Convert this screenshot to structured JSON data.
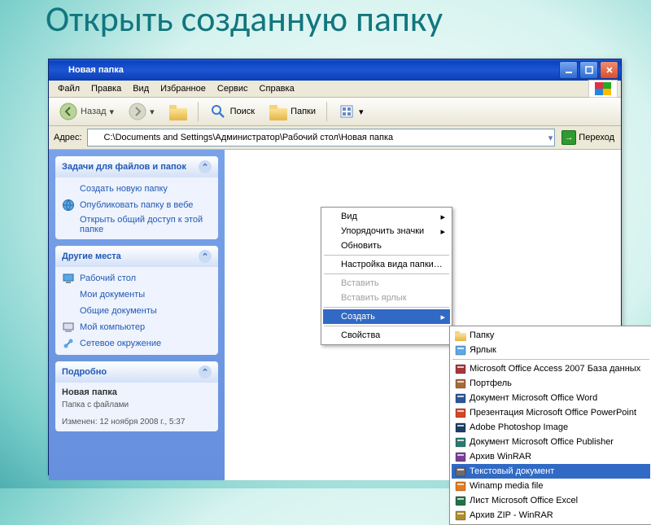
{
  "slide_title": "Открыть созданную папку",
  "window": {
    "title": "Новая папка",
    "menubar": [
      "Файл",
      "Правка",
      "Вид",
      "Избранное",
      "Сервис",
      "Справка"
    ],
    "toolbar": {
      "back": "Назад",
      "search": "Поиск",
      "folders": "Папки"
    },
    "address_label": "Адрес:",
    "address_value": "C:\\Documents and Settings\\Администратор\\Рабочий стол\\Новая папка",
    "go": "Переход"
  },
  "sidebar": {
    "tasks": {
      "title": "Задачи для файлов и папок",
      "items": [
        "Создать новую папку",
        "Опубликовать папку в вебе",
        "Открыть общий доступ к этой папке"
      ]
    },
    "places": {
      "title": "Другие места",
      "items": [
        "Рабочий стол",
        "Мои документы",
        "Общие документы",
        "Мой компьютер",
        "Сетевое окружение"
      ]
    },
    "details": {
      "title": "Подробно",
      "name": "Новая папка",
      "type": "Папка с файлами",
      "modified": "Изменен: 12 ноября 2008 г., 5:37"
    }
  },
  "context_menu": {
    "items": [
      {
        "label": "Вид",
        "arrow": true
      },
      {
        "label": "Упорядочить значки",
        "arrow": true
      },
      {
        "label": "Обновить"
      },
      {
        "sep": true
      },
      {
        "label": "Настройка вида папки…"
      },
      {
        "sep": true
      },
      {
        "label": "Вставить",
        "disabled": true
      },
      {
        "label": "Вставить ярлык",
        "disabled": true
      },
      {
        "sep": true
      },
      {
        "label": "Создать",
        "arrow": true,
        "hi": true
      },
      {
        "sep": true
      },
      {
        "label": "Свойства"
      }
    ]
  },
  "submenu": {
    "items": [
      {
        "label": "Папку",
        "icon": "folder"
      },
      {
        "label": "Ярлык",
        "icon": "shortcut"
      },
      {
        "sep": true
      },
      {
        "label": "Microsoft Office Access 2007 База данных",
        "icon": "access"
      },
      {
        "label": "Портфель",
        "icon": "briefcase"
      },
      {
        "label": "Документ Microsoft Office Word",
        "icon": "word"
      },
      {
        "label": "Презентация Microsoft Office PowerPoint",
        "icon": "ppt"
      },
      {
        "label": "Adobe Photoshop Image",
        "icon": "ps"
      },
      {
        "label": "Документ Microsoft Office Publisher",
        "icon": "pub"
      },
      {
        "label": "Архив WinRAR",
        "icon": "rar"
      },
      {
        "label": "Текстовый документ",
        "icon": "txt",
        "hi": true
      },
      {
        "label": "Winamp media file",
        "icon": "winamp"
      },
      {
        "label": "Лист Microsoft Office Excel",
        "icon": "excel"
      },
      {
        "label": "Архив ZIP - WinRAR",
        "icon": "zip"
      }
    ]
  },
  "icon_colors": {
    "folder": "#e5b545",
    "shortcut": "#5aa9e6",
    "access": "#a4373a",
    "briefcase": "#a86a3b",
    "word": "#2b579a",
    "ppt": "#d24726",
    "ps": "#1a3e66",
    "pub": "#2a7a6f",
    "rar": "#7a3e9d",
    "txt": "#6c6c6c",
    "winamp": "#e47b1f",
    "excel": "#217346",
    "zip": "#b08b2f"
  }
}
